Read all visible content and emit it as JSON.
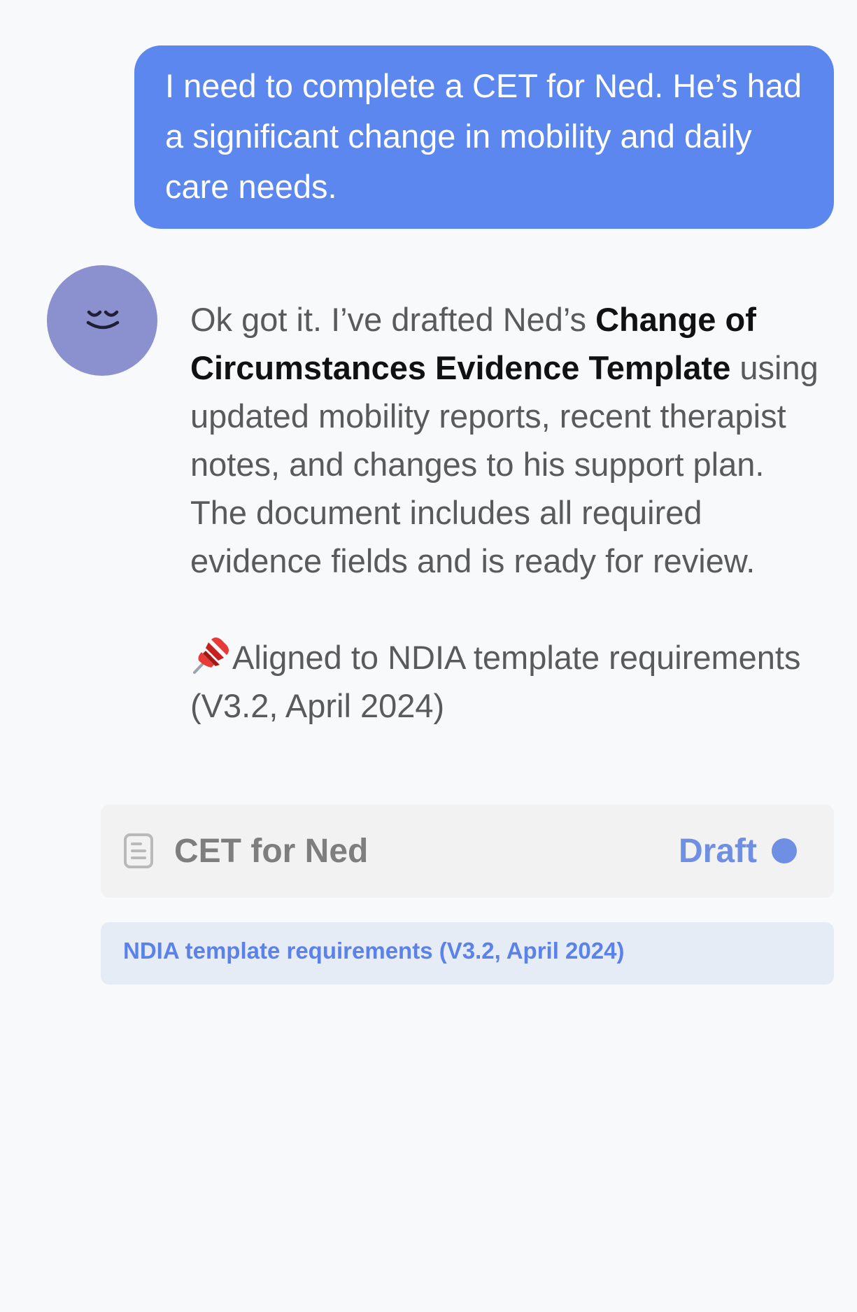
{
  "user_message": {
    "text": "I need to complete a CET for Ned. He’s had a significant change in mobility and daily care needs."
  },
  "assistant_message": {
    "intro": "Ok got it. I’ve drafted Ned’s ",
    "bold_title": "Change of Circumstances Evidence Template",
    "body": " using updated mobility reports, recent therapist notes, and changes to his support plan. The document includes all required evidence fields and is ready for review.",
    "pin_icon": "pushpin-icon",
    "note": "Aligned to NDIA template requirements (V3.2, April 2024)"
  },
  "avatar": {
    "icon": "sleepy-face-icon",
    "color": "#8b90cf"
  },
  "document_card": {
    "icon": "document-icon",
    "title": "CET for Ned",
    "status": "Draft",
    "status_color": "#6f8fe3"
  },
  "reference_chip": {
    "label": "NDIA template requirements (V3.2, April 2024)"
  },
  "colors": {
    "user_bubble": "#5b87ee",
    "background": "#f8f9fb",
    "card_background": "#f2f2f3",
    "chip_background": "#e6ecf6",
    "chip_text": "#5b82e8"
  }
}
